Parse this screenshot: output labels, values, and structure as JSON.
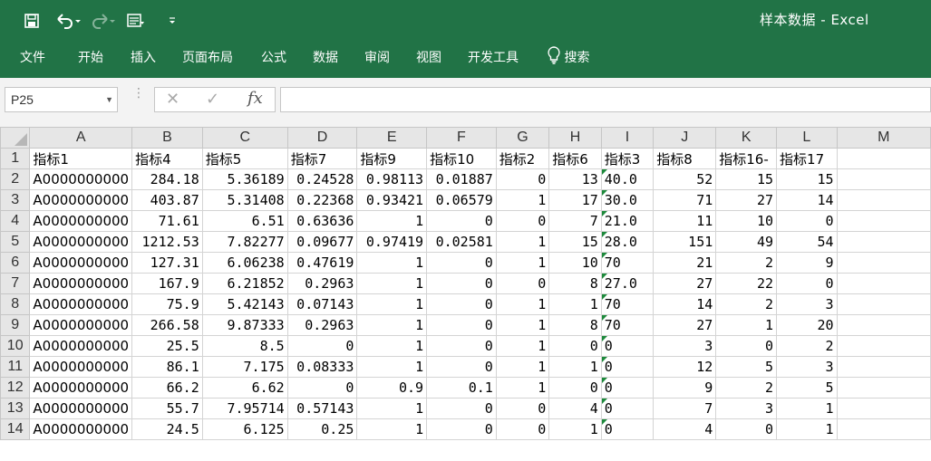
{
  "app": {
    "title": "样本数据 - Excel",
    "quick_access": [
      "save-icon",
      "undo-icon",
      "redo-icon",
      "form-icon",
      "customize-icon"
    ]
  },
  "ribbon": {
    "tabs": [
      "文件",
      "开始",
      "插入",
      "页面布局",
      "公式",
      "数据",
      "审阅",
      "视图",
      "开发工具"
    ],
    "search_label": "搜索"
  },
  "formula_bar": {
    "name_box": "P25",
    "fx_label": "fx",
    "formula": ""
  },
  "sheet": {
    "columns": [
      "A",
      "B",
      "C",
      "D",
      "E",
      "F",
      "G",
      "H",
      "I",
      "J",
      "K",
      "L",
      "M"
    ],
    "rows": [
      {
        "n": "1",
        "cells": [
          "指标1",
          "指标4",
          "指标5",
          "指标7",
          "指标9",
          "指标10",
          "指标2",
          "指标6",
          "指标3",
          "指标8",
          "指标16-",
          "指标17",
          ""
        ]
      },
      {
        "n": "2",
        "cells": [
          "A0000000000",
          "284.18",
          "5.36189",
          "0.24528",
          "0.98113",
          "0.01887",
          "0",
          "13",
          "40.0",
          "52",
          "15",
          "15",
          ""
        ]
      },
      {
        "n": "3",
        "cells": [
          "A0000000000",
          "403.87",
          "5.31408",
          "0.22368",
          "0.93421",
          "0.06579",
          "1",
          "17",
          "30.0",
          "71",
          "27",
          "14",
          ""
        ]
      },
      {
        "n": "4",
        "cells": [
          "A0000000000",
          "71.61",
          "6.51",
          "0.63636",
          "1",
          "0",
          "0",
          "7",
          "21.0",
          "11",
          "10",
          "0",
          ""
        ]
      },
      {
        "n": "5",
        "cells": [
          "A0000000000",
          "1212.53",
          "7.82277",
          "0.09677",
          "0.97419",
          "0.02581",
          "1",
          "15",
          "28.0",
          "151",
          "49",
          "54",
          ""
        ]
      },
      {
        "n": "6",
        "cells": [
          "A0000000000",
          "127.31",
          "6.06238",
          "0.47619",
          "1",
          "0",
          "1",
          "10",
          "70",
          "21",
          "2",
          "9",
          ""
        ]
      },
      {
        "n": "7",
        "cells": [
          "A0000000000",
          "167.9",
          "6.21852",
          "0.2963",
          "1",
          "0",
          "0",
          "8",
          "27.0",
          "27",
          "22",
          "0",
          ""
        ]
      },
      {
        "n": "8",
        "cells": [
          "A0000000000",
          "75.9",
          "5.42143",
          "0.07143",
          "1",
          "0",
          "1",
          "1",
          "70",
          "14",
          "2",
          "3",
          ""
        ]
      },
      {
        "n": "9",
        "cells": [
          "A0000000000",
          "266.58",
          "9.87333",
          "0.2963",
          "1",
          "0",
          "1",
          "8",
          "70",
          "27",
          "1",
          "20",
          ""
        ]
      },
      {
        "n": "10",
        "cells": [
          "A0000000000",
          "25.5",
          "8.5",
          "0",
          "1",
          "0",
          "1",
          "0",
          "0",
          "3",
          "0",
          "2",
          ""
        ]
      },
      {
        "n": "11",
        "cells": [
          "A0000000000",
          "86.1",
          "7.175",
          "0.08333",
          "1",
          "0",
          "1",
          "1",
          "0",
          "12",
          "5",
          "3",
          ""
        ]
      },
      {
        "n": "12",
        "cells": [
          "A0000000000",
          "66.2",
          "6.62",
          "0",
          "0.9",
          "0.1",
          "1",
          "0",
          "0",
          "9",
          "2",
          "5",
          ""
        ]
      },
      {
        "n": "13",
        "cells": [
          "A0000000000",
          "55.7",
          "7.95714",
          "0.57143",
          "1",
          "0",
          "0",
          "4",
          "0",
          "7",
          "3",
          "1",
          ""
        ]
      },
      {
        "n": "14",
        "cells": [
          "A0000000000",
          "24.5",
          "6.125",
          "0.25",
          "1",
          "0",
          "0",
          "1",
          "0",
          "4",
          "0",
          "1",
          ""
        ]
      }
    ]
  },
  "colors": {
    "ribbon_green": "#217346",
    "text_indicator": "#1e8a3c"
  }
}
